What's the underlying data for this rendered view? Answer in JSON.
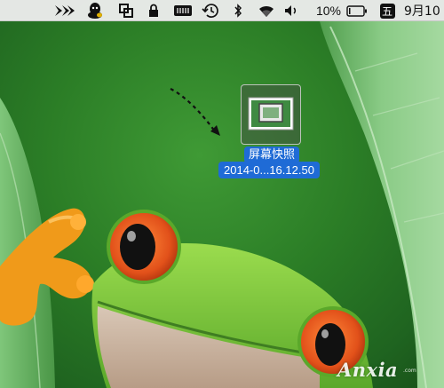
{
  "menubar": {
    "icons": [
      "app-arrow-icon",
      "qq-penguin-icon",
      "screen-capture-icon",
      "lock-icon",
      "battery-status-icon",
      "time-machine-icon",
      "bluetooth-icon",
      "wifi-icon",
      "volume-icon",
      "battery-icon",
      "input-method-icon"
    ],
    "battery_percent": "10%",
    "battery_level": 0.1,
    "input_method_label": "五",
    "date_text": "9月10"
  },
  "desktop": {
    "file": {
      "name_line1": "屏幕快照",
      "name_line2": "2014-0...16.12.50"
    },
    "watermark": {
      "text": "Anxia",
      "subtext": ".com"
    }
  },
  "colors": {
    "menubar_bg": "#ececec",
    "selection_blue": "#1f6bd6",
    "frog_green": "#7ac943",
    "frog_eye_orange": "#e8541a",
    "leaf_green": "#6ab56a"
  }
}
